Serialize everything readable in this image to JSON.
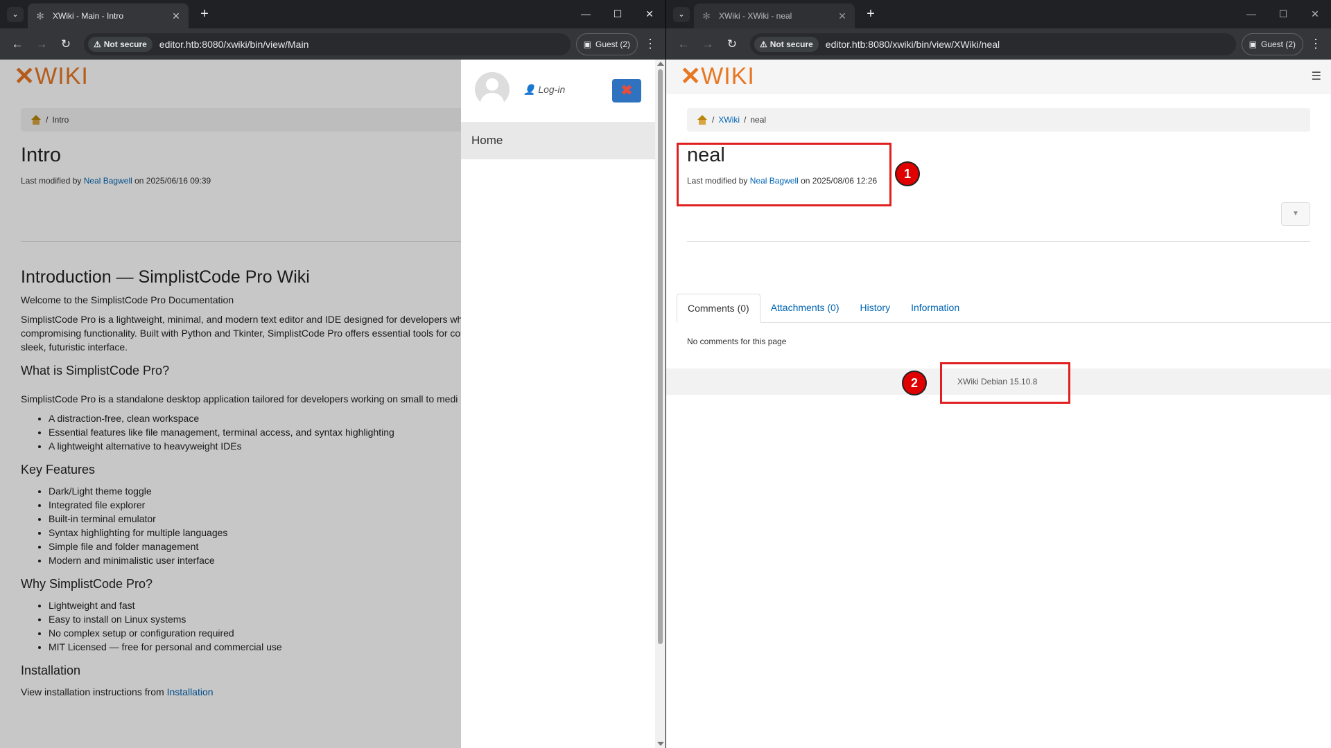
{
  "left": {
    "tab_title": "XWiki - Main - Intro",
    "security_label": "Not secure",
    "url": "editor.htb:8080/xwiki/bin/view/Main",
    "profile_label": "Guest (2)",
    "logo_wiki": "WIKI",
    "breadcrumb_current": "Intro",
    "page_title": "Intro",
    "modified_prefix": "Last modified by",
    "modified_author": "Neal Bagwell",
    "modified_suffix": "on 2025/06/16 09:39",
    "article": {
      "h1": "Introduction — SimplistCode Pro Wiki",
      "welcome": "Welcome to the SimplistCode Pro Documentation",
      "intro_line1": "SimplistCode Pro is a lightweight, minimal, and modern text editor and IDE designed for developers wh",
      "intro_line2": "compromising functionality. Built with Python and Tkinter, SimplistCode Pro offers essential tools for co",
      "intro_line3": "sleek, futuristic interface.",
      "h2_what": "What is SimplistCode Pro?",
      "what_text": "SimplistCode Pro is a standalone desktop application tailored for developers working on small to medi",
      "what_items": [
        "A distraction-free, clean workspace",
        "Essential features like file management, terminal access, and syntax highlighting",
        "A lightweight alternative to heavyweight IDEs"
      ],
      "h2_features": "Key Features",
      "feature_items": [
        "Dark/Light theme toggle",
        "Integrated file explorer",
        "Built-in terminal emulator",
        "Syntax highlighting for multiple languages",
        "Simple file and folder management",
        "Modern and minimalistic user interface"
      ],
      "h2_why": "Why SimplistCode Pro?",
      "why_items": [
        "Lightweight and fast",
        "Easy to install on Linux systems",
        "No complex setup or configuration required",
        "MIT Licensed — free for personal and commercial use"
      ],
      "h2_install": "Installation",
      "install_prefix": "View installation instructions from",
      "install_link": "Installation"
    },
    "drawer": {
      "login": "Log-in",
      "close": "✖",
      "home": "Home"
    }
  },
  "right": {
    "tab_title": "XWiki - XWiki - neal",
    "security_label": "Not secure",
    "url": "editor.htb:8080/xwiki/bin/view/XWiki/neal",
    "profile_label": "Guest (2)",
    "logo_wiki": "WIKI",
    "breadcrumb_space": "XWiki",
    "breadcrumb_current": "neal",
    "page_title": "neal",
    "modified_prefix": "Last modified by",
    "modified_author": "Neal Bagwell",
    "modified_suffix": "on 2025/08/06 12:26",
    "tabs": [
      "Comments (0)",
      "Attachments (0)",
      "History",
      "Information"
    ],
    "no_comments": "No comments for this page",
    "footer": "XWiki Debian 15.10.8",
    "annotations": [
      "1",
      "2"
    ]
  },
  "colors": {
    "accent": "#0064b3",
    "logo_orange": "#e87722",
    "annotation_red": "#e02020"
  }
}
